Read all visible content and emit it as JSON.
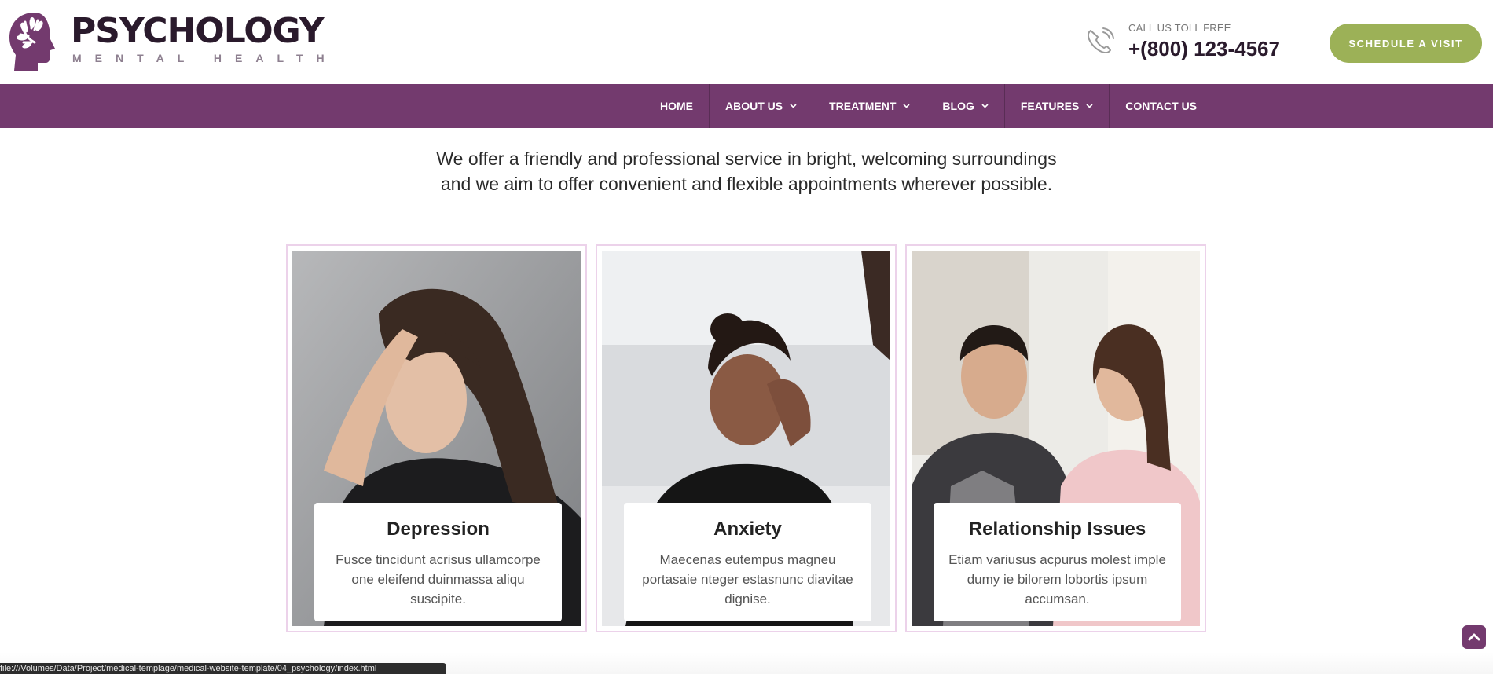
{
  "brand": {
    "name": "PSYCHOLOGY",
    "tagline": "MENTAL HEALTH",
    "logo_icon": "head-leaf-logo-icon",
    "primary_color": "#733a6e",
    "accent_color": "#9cb157"
  },
  "header": {
    "phone_label": "CALL US TOLL FREE",
    "phone_number": "+(800) 123-4567",
    "phone_icon": "phone-icon",
    "cta_label": "SCHEDULE A VISIT"
  },
  "nav": {
    "items": [
      {
        "label": "HOME",
        "has_dropdown": false
      },
      {
        "label": "ABOUT US",
        "has_dropdown": true
      },
      {
        "label": "TREATMENT",
        "has_dropdown": true
      },
      {
        "label": "BLOG",
        "has_dropdown": true
      },
      {
        "label": "FEATURES",
        "has_dropdown": true
      },
      {
        "label": "CONTACT US",
        "has_dropdown": false
      }
    ]
  },
  "intro": {
    "line1": "We offer a friendly and professional service in bright, welcoming surroundings",
    "line2": "and we aim to offer convenient and flexible appointments wherever possible."
  },
  "cards": [
    {
      "title": "Depression",
      "text": "Fusce tincidunt acrisus ullamcorpe one eleifend duinmassa aliqu suscipite."
    },
    {
      "title": "Anxiety",
      "text": "Maecenas eutempus magneu portasaie nteger estasnunc diavitae dignise."
    },
    {
      "title": "Relationship Issues",
      "text": "Etiam variusus acpurus molest imple dumy ie bilorem lobortis ipsum accumsan."
    }
  ],
  "scroll_top_icon": "chevron-up-icon",
  "status_bar": {
    "url": "file:///Volumes/Data/Project/medical-templage/medical-website-template/04_psychology/index.html"
  }
}
